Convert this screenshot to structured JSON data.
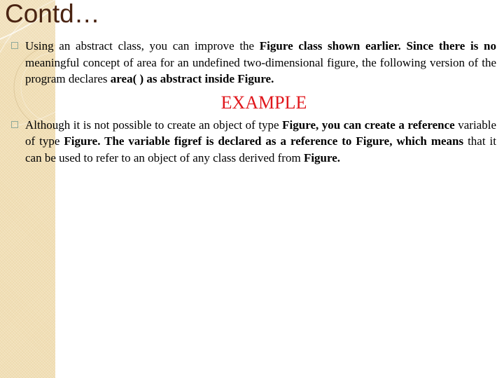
{
  "slide": {
    "title": "Contd…",
    "colors": {
      "title": "#4a2412",
      "example_heading": "#e0161b",
      "side_panel": "#f1dfb6",
      "bullet_box": "#8fa99a"
    },
    "bullets": [
      {
        "icon": "square-bullet-icon",
        "segments": [
          {
            "text": "Using an abstract class, you can improve the ",
            "bold": false
          },
          {
            "text": "Figure class shown earlier. Since there is no",
            "bold": true
          },
          {
            "text": " meaningful concept of area for an undefined two-dimensional figure, the following version of the program declares ",
            "bold": false
          },
          {
            "text": "area( ) as abstract inside Figure.",
            "bold": true
          }
        ]
      },
      {
        "icon": "square-bullet-icon",
        "segments": [
          {
            "text": "Although it is not possible to create an object of type ",
            "bold": false
          },
          {
            "text": "Figure, you can create a reference",
            "bold": true
          },
          {
            "text": " variable of type ",
            "bold": false
          },
          {
            "text": "Figure. The variable figref is declared as a reference to Figure, which means",
            "bold": true
          },
          {
            "text": " that it can be used to refer to an object of any class derived from ",
            "bold": false
          },
          {
            "text": "Figure.",
            "bold": true
          }
        ]
      }
    ],
    "example_heading": "EXAMPLE"
  }
}
